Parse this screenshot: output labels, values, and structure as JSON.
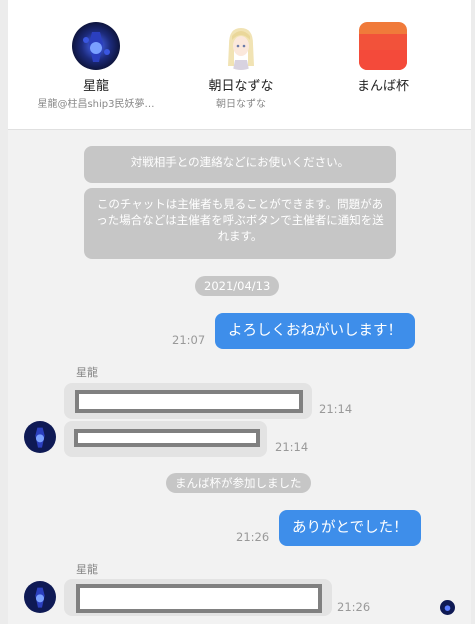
{
  "participants": [
    {
      "name": "星龍",
      "subtitle": "星龍@柱昌ship3民妖夢…"
    },
    {
      "name": "朝日なずな",
      "subtitle": "朝日なずな"
    },
    {
      "name": "まんば杯",
      "subtitle": ""
    }
  ],
  "system": {
    "notice1": "対戦相手との連絡などにお使いください。",
    "notice2": "このチャットは主催者も見ることができます。問題があった場合などは主催者を呼ぶボタンで主催者に通知を送れます。"
  },
  "date_pill": "2021/04/13",
  "messages": {
    "m1": {
      "text": "よろしくおねがいします！",
      "time": "21:07"
    },
    "sender1": "星龍",
    "m2_time": "21:14",
    "m3_time": "21:14",
    "join_notice": "まんば杯が参加しました",
    "m4": {
      "text": "ありがとでした！",
      "time": "21:26"
    },
    "sender2": "星龍",
    "m5_time": "21:26"
  },
  "colors": {
    "outgoing": "#3e8eea",
    "incoming": "#e3e3e3",
    "system": "#c6c6c6"
  }
}
